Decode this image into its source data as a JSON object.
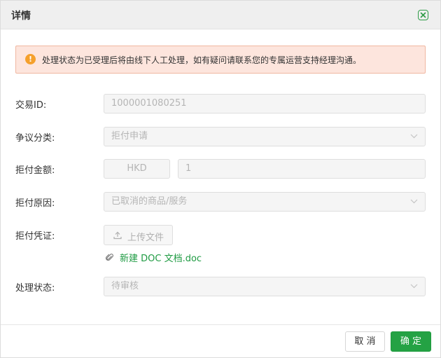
{
  "dialog": {
    "title": "详情",
    "close_icon": "close-icon"
  },
  "alert": {
    "icon": "warning-icon",
    "message": "处理状态为已受理后将由线下人工处理，如有疑问请联系您的专属运营支持经理沟通。"
  },
  "form": {
    "transaction_id": {
      "label": "交易ID:",
      "value": "1000001080251"
    },
    "dispute_type": {
      "label": "争议分类:",
      "value": "拒付申请"
    },
    "chargeback_amount": {
      "label": "拒付金额:",
      "currency": "HKD",
      "amount": "1"
    },
    "chargeback_reason": {
      "label": "拒付原因:",
      "value": "已取消的商品/服务"
    },
    "chargeback_proof": {
      "label": "拒付凭证:",
      "upload_label": "上传文件",
      "file_name": "新建 DOC 文档.doc"
    },
    "process_status": {
      "label": "处理状态:",
      "value": "待审核"
    }
  },
  "footer": {
    "cancel_label": "取 消",
    "confirm_label": "确 定"
  },
  "colors": {
    "primary": "#24a244",
    "alert_bg": "#fde5dd",
    "alert_border": "#f0b7a1",
    "warning": "#f5a02c"
  }
}
